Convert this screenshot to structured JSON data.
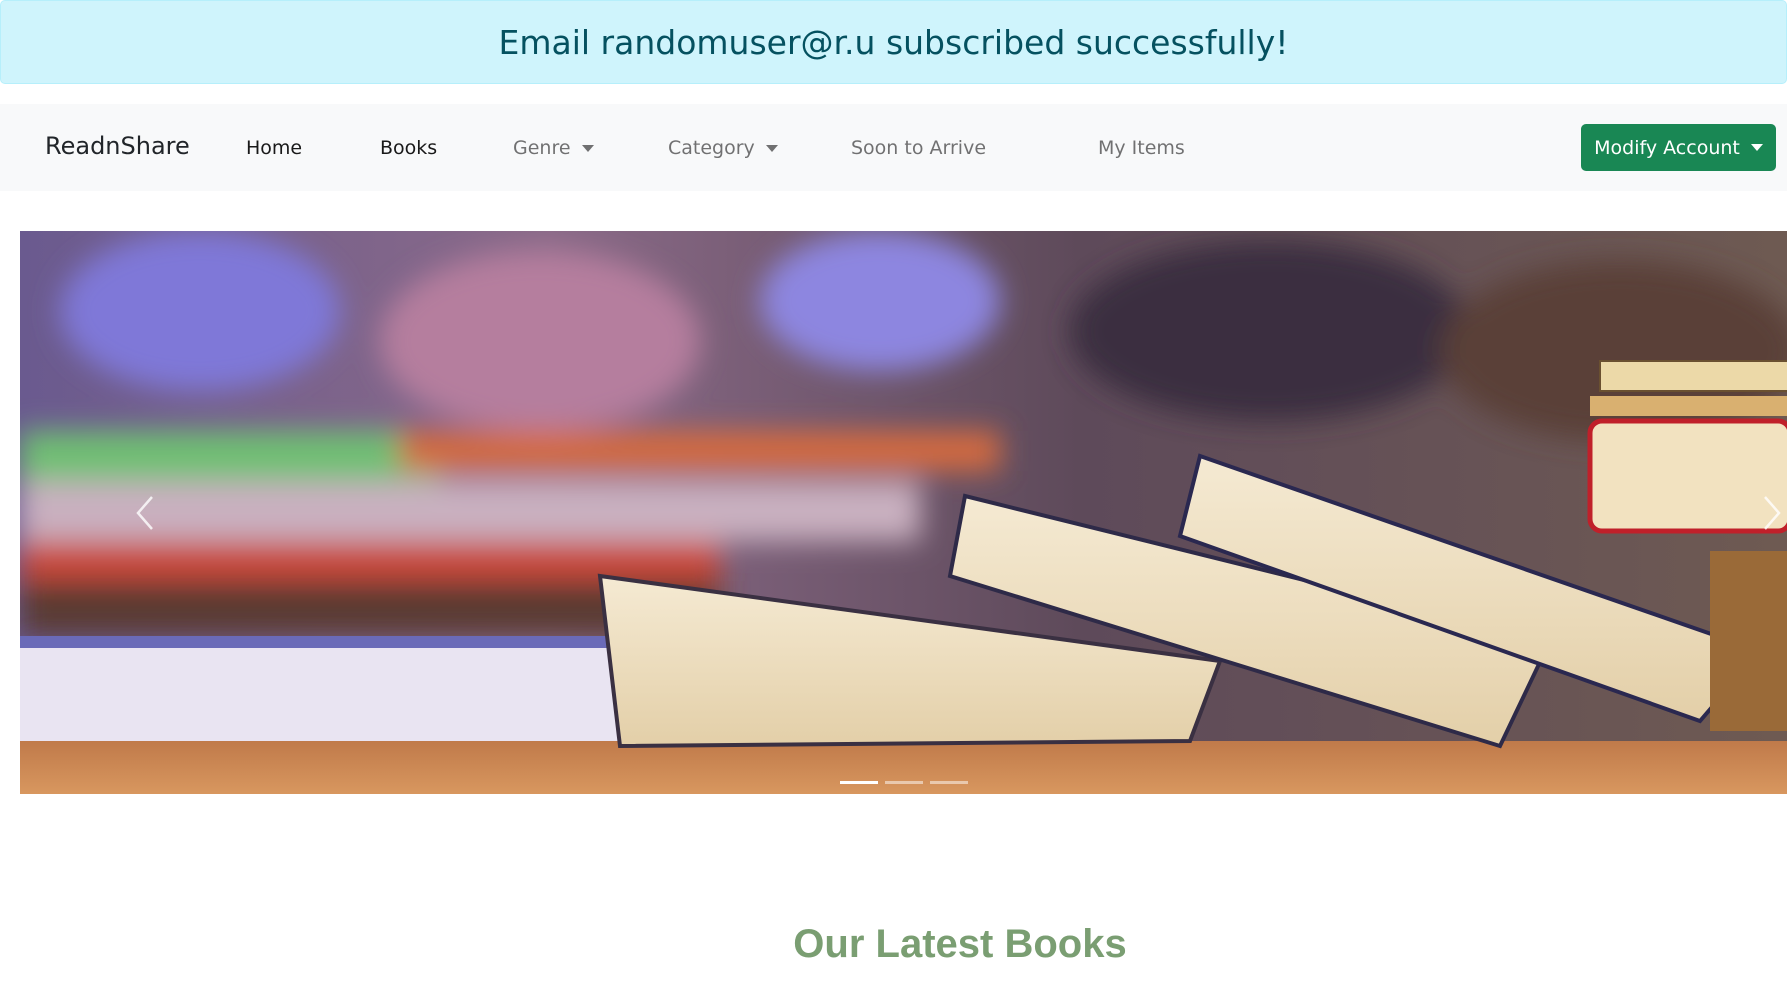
{
  "alert": {
    "message": "Email randomuser@r.u subscribed successfully!"
  },
  "navbar": {
    "brand": "ReadnShare",
    "items": [
      {
        "label": "Home"
      },
      {
        "label": "Books"
      },
      {
        "label": "Genre"
      },
      {
        "label": "Category"
      },
      {
        "label": "Soon to Arrive"
      },
      {
        "label": "My Items"
      }
    ],
    "account_button": "Modify Account"
  },
  "carousel": {
    "image": "books-on-table-photo",
    "slides": 3,
    "active_slide": 1,
    "prev_icon": "chevron-left-icon",
    "next_icon": "chevron-right-icon"
  },
  "main": {
    "section_title": "Our Latest Books"
  },
  "colors": {
    "alert_bg": "#cff4fc",
    "alert_text": "#055160",
    "navbar_bg": "#f8f9fa",
    "account_button": "#198754",
    "section_title": "#7a9e72"
  }
}
